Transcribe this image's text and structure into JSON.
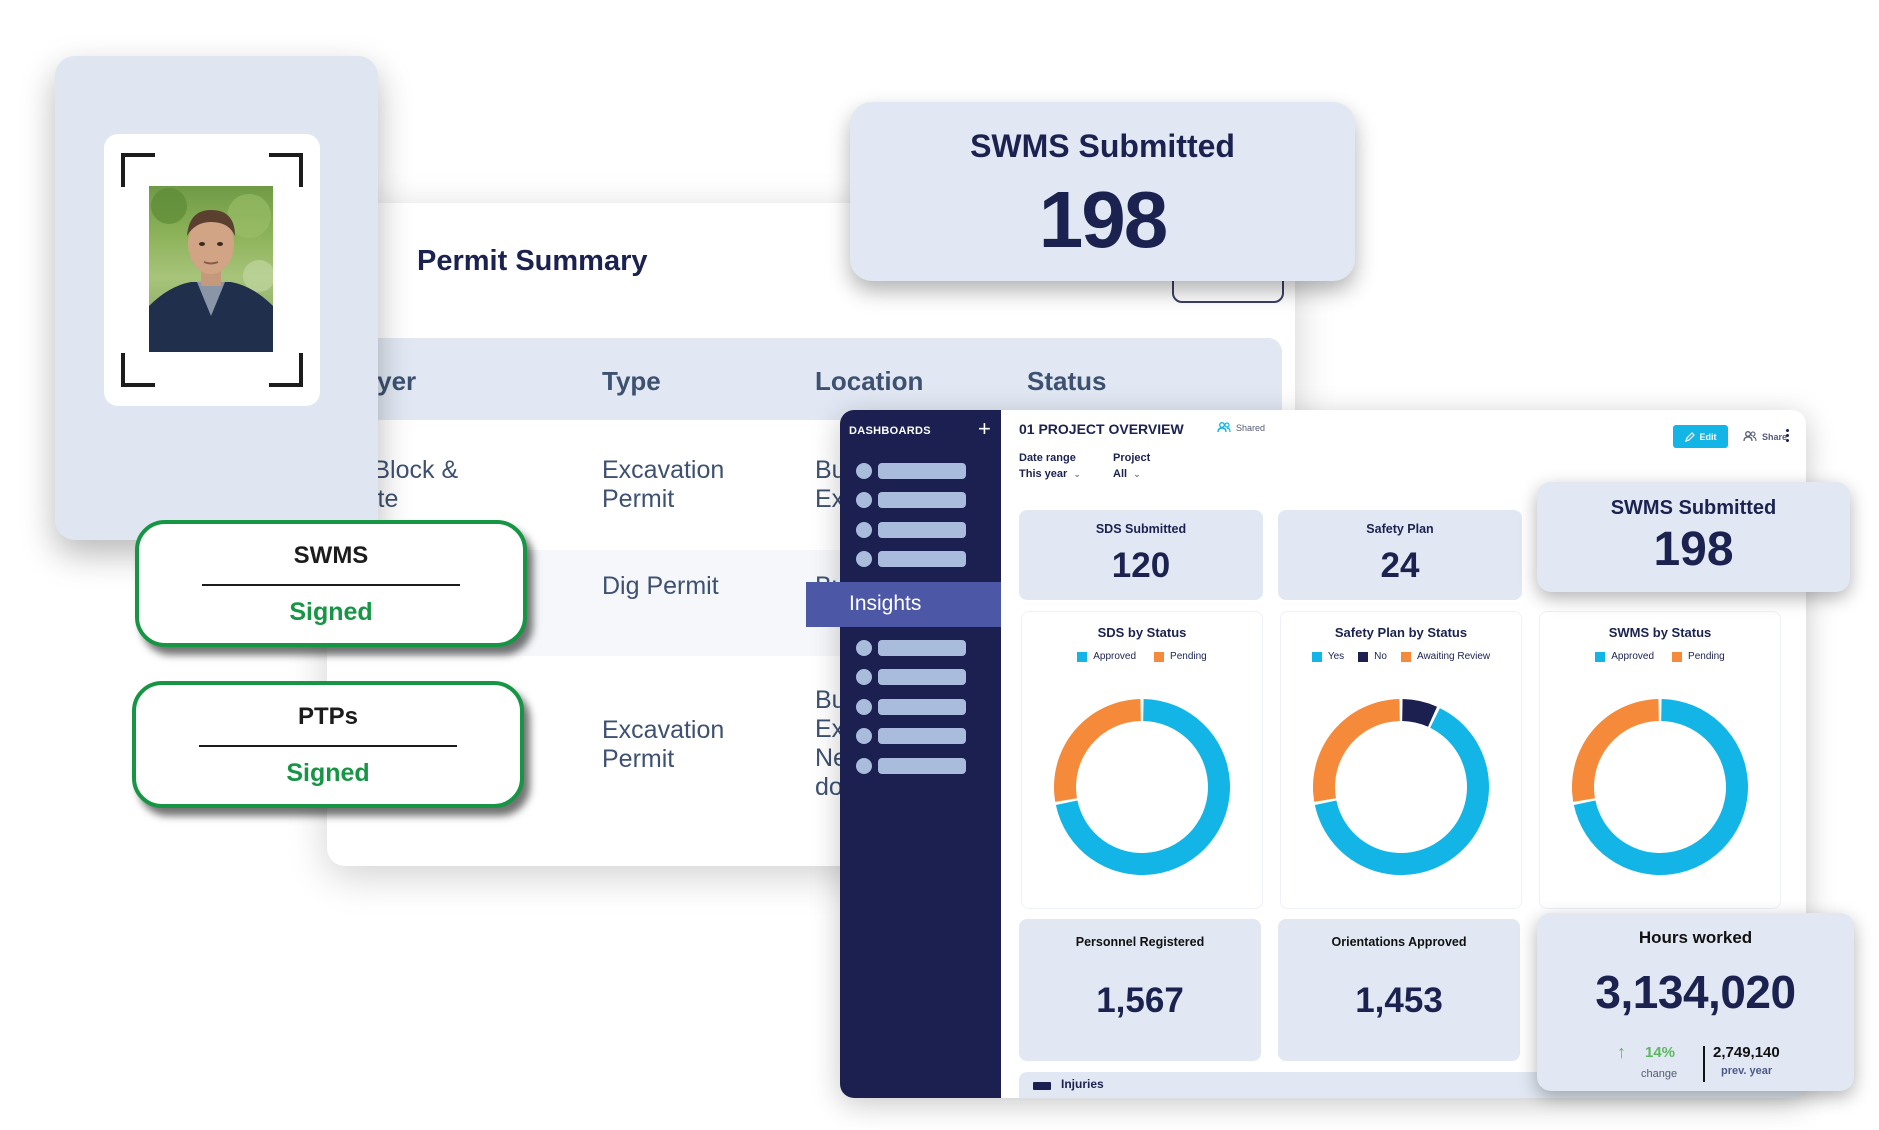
{
  "permit_summary": {
    "title": "Permit Summary",
    "columns": [
      "mployer",
      "Type",
      "Location",
      "Status"
    ],
    "rows": [
      {
        "employer": "alley Block &\noncrete",
        "type": "Excavation\nPermit",
        "location": "Bu\nEx"
      },
      {
        "employer": "",
        "type": "Dig Permit",
        "location": "Bu"
      },
      {
        "employer": "",
        "type": "Excavation\nPermit",
        "location": "Bu\nEx\nNe\ndo"
      }
    ]
  },
  "signed_badges": [
    {
      "title": "SWMS",
      "status": "Signed"
    },
    {
      "title": "PTPs",
      "status": "Signed"
    }
  ],
  "floating_swms": {
    "label": "SWMS Submitted",
    "value": "198"
  },
  "sidebar": {
    "title": "DASHBOARDS",
    "add_icon": "+",
    "active_item": "Insights"
  },
  "dashboard": {
    "title": "01 PROJECT OVERVIEW",
    "shared_label": "Shared",
    "edit_label": "Edit",
    "share_label": "Share",
    "filters": [
      {
        "label": "Date range",
        "value": "This year"
      },
      {
        "label": "Project",
        "value": "All"
      }
    ],
    "kpis": {
      "sds_submitted": {
        "label": "SDS Submitted",
        "value": "120"
      },
      "safety_plan": {
        "label": "Safety Plan",
        "value": "24"
      },
      "swms_submitted": {
        "label": "SWMS Submitted",
        "value": "198"
      },
      "personnel_registered": {
        "label": "Personnel Registered",
        "value": "1,567"
      },
      "orientations_approved": {
        "label": "Orientations Approved",
        "value": "1,453"
      },
      "hours_worked": {
        "label": "Hours worked",
        "value": "3,134,020",
        "change_value": "14%",
        "change_caption": "change",
        "prev_value": "2,749,140",
        "prev_caption": "prev. year"
      }
    },
    "injuries_label": "Injuries"
  },
  "colors": {
    "approved": "#12b5e6",
    "pending": "#f58a3a",
    "no": "#1b2050",
    "brand_dark": "#1b2050",
    "accent": "#4c58a6",
    "signed_green": "#169645"
  },
  "chart_data": [
    {
      "type": "pie",
      "title": "SDS by Status",
      "donut": true,
      "categories": [
        "Approved",
        "Pending"
      ],
      "values": [
        72,
        28
      ],
      "colors": [
        "#12b5e6",
        "#f58a3a"
      ],
      "legend": "top"
    },
    {
      "type": "pie",
      "title": "Safety Plan by Status",
      "donut": true,
      "categories": [
        "Yes",
        "No",
        "Awaiting Review"
      ],
      "values": [
        65,
        7,
        28
      ],
      "colors": [
        "#12b5e6",
        "#1b2050",
        "#f58a3a"
      ],
      "legend": "top"
    },
    {
      "type": "pie",
      "title": "SWMS by Status",
      "donut": true,
      "categories": [
        "Approved",
        "Pending"
      ],
      "values": [
        72,
        28
      ],
      "colors": [
        "#12b5e6",
        "#f58a3a"
      ],
      "legend": "top"
    }
  ]
}
